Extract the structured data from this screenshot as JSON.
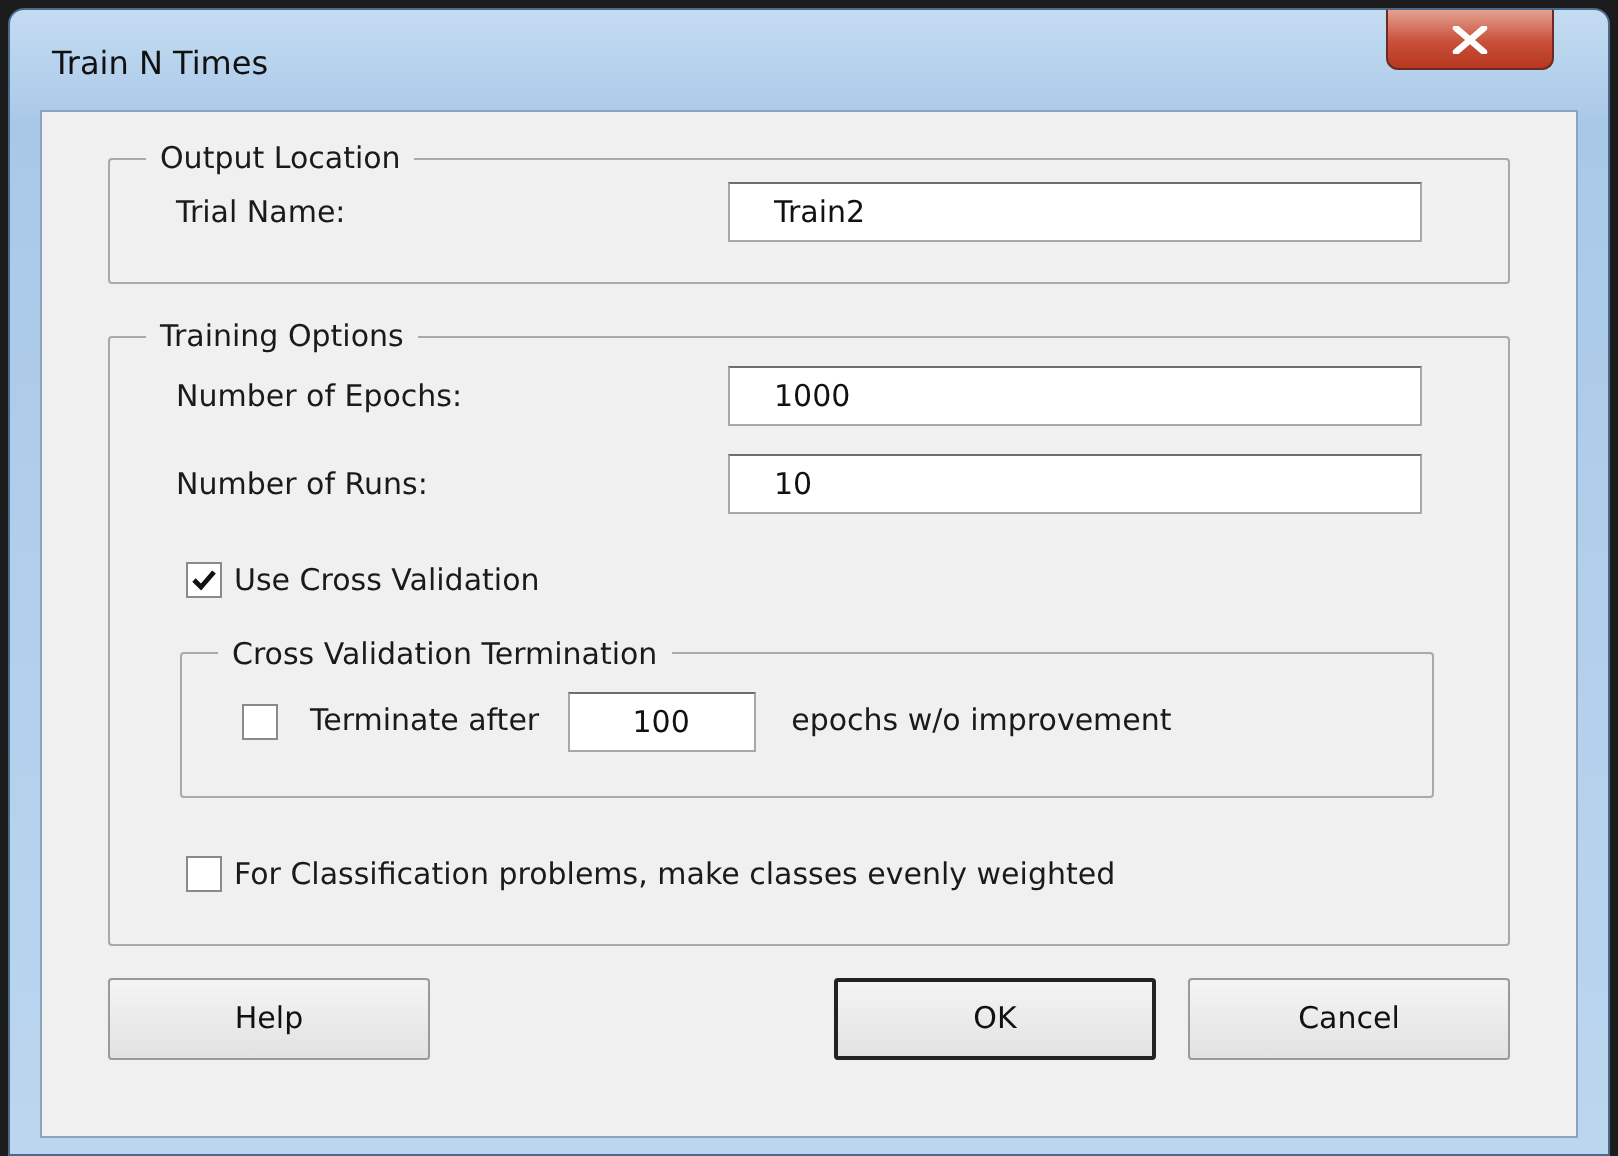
{
  "window": {
    "title": "Train N Times"
  },
  "output_location": {
    "title": "Output Location",
    "fields": [
      {
        "label": "Trial Name:",
        "value": "Train2"
      }
    ]
  },
  "training_options": {
    "title": "Training Options",
    "fields": [
      {
        "label": "Number of Epochs:",
        "value": "1000"
      },
      {
        "label": "Number of Runs:",
        "value": "10"
      }
    ],
    "use_cross_validation": {
      "label": "Use Cross Validation",
      "checked": true
    },
    "cross_validation_termination": {
      "title": "Cross Validation Termination",
      "checked": false,
      "label": "Terminate after",
      "value": "100",
      "suffix": "epochs w/o improvement"
    },
    "even_weights": {
      "label": "For Classification problems, make classes evenly weighted",
      "checked": false
    }
  },
  "buttons": [
    {
      "label": "Help",
      "default": false
    },
    {
      "label": "OK",
      "default": true
    },
    {
      "label": "Cancel",
      "default": false
    }
  ]
}
